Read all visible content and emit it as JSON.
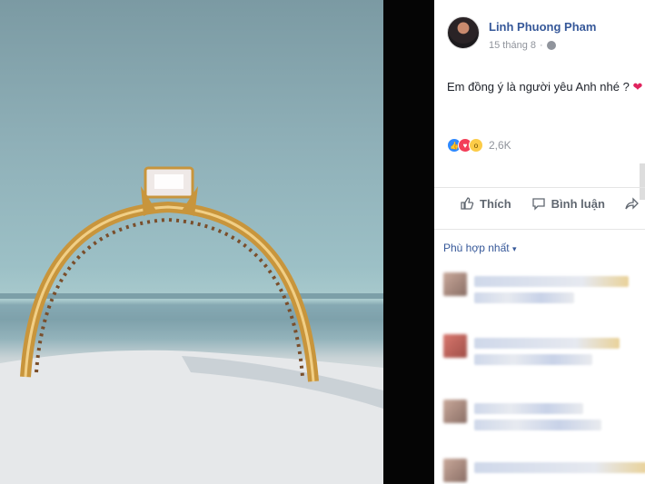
{
  "post": {
    "author": "Linh Phuong Pham",
    "timestamp": "15 tháng 8",
    "privacy_icon": "globe-icon",
    "status_text": "Em đồng ý là người yêu Anh nhé ?",
    "status_emoji": "❤",
    "reaction_count": "2,6K",
    "reaction_icons": [
      "like-icon",
      "love-icon",
      "wow-icon"
    ],
    "actions": {
      "like": "Thích",
      "comment": "Bình luận"
    },
    "comment_sort": "Phù hợp nhất",
    "comment_sort_caret": "▾"
  },
  "colors": {
    "link": "#365899",
    "like": "#2e89ff",
    "love": "#f33e58",
    "wow": "#fccc48",
    "gold": "#c8953c"
  }
}
